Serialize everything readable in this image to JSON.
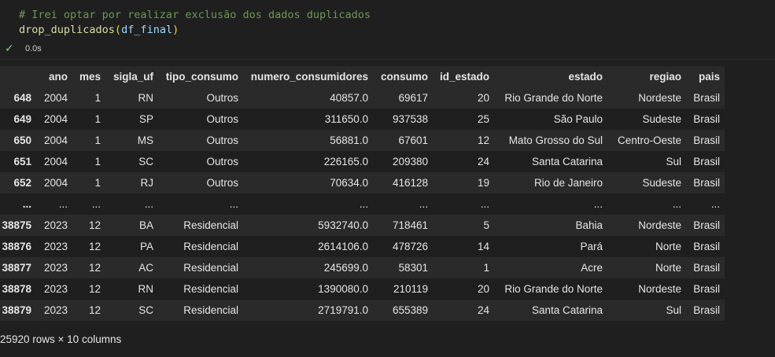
{
  "code": {
    "comment": "# Irei optar por realizar exclusão dos dados duplicados",
    "fn_name": "drop_duplicados",
    "open_paren": "(",
    "arg": "df_final",
    "close_paren": ")"
  },
  "status": {
    "duration": "0.0s"
  },
  "table": {
    "columns": [
      "",
      "ano",
      "mes",
      "sigla_uf",
      "tipo_consumo",
      "numero_consumidores",
      "consumo",
      "id_estado",
      "estado",
      "regiao",
      "pais"
    ],
    "rows": [
      [
        "648",
        "2004",
        "1",
        "RN",
        "Outros",
        "40857.0",
        "69617",
        "20",
        "Rio Grande do Norte",
        "Nordeste",
        "Brasil"
      ],
      [
        "649",
        "2004",
        "1",
        "SP",
        "Outros",
        "311650.0",
        "937538",
        "25",
        "São Paulo",
        "Sudeste",
        "Brasil"
      ],
      [
        "650",
        "2004",
        "1",
        "MS",
        "Outros",
        "56881.0",
        "67601",
        "12",
        "Mato Grosso do Sul",
        "Centro-Oeste",
        "Brasil"
      ],
      [
        "651",
        "2004",
        "1",
        "SC",
        "Outros",
        "226165.0",
        "209380",
        "24",
        "Santa Catarina",
        "Sul",
        "Brasil"
      ],
      [
        "652",
        "2004",
        "1",
        "RJ",
        "Outros",
        "70634.0",
        "416128",
        "19",
        "Rio de Janeiro",
        "Sudeste",
        "Brasil"
      ],
      [
        "...",
        "...",
        "...",
        "...",
        "...",
        "...",
        "...",
        "...",
        "...",
        "...",
        "..."
      ],
      [
        "38875",
        "2023",
        "12",
        "BA",
        "Residencial",
        "5932740.0",
        "718461",
        "5",
        "Bahia",
        "Nordeste",
        "Brasil"
      ],
      [
        "38876",
        "2023",
        "12",
        "PA",
        "Residencial",
        "2614106.0",
        "478726",
        "14",
        "Pará",
        "Norte",
        "Brasil"
      ],
      [
        "38877",
        "2023",
        "12",
        "AC",
        "Residencial",
        "245699.0",
        "58301",
        "1",
        "Acre",
        "Norte",
        "Brasil"
      ],
      [
        "38878",
        "2023",
        "12",
        "RN",
        "Residencial",
        "1390080.0",
        "210119",
        "20",
        "Rio Grande do Norte",
        "Nordeste",
        "Brasil"
      ],
      [
        "38879",
        "2023",
        "12",
        "SC",
        "Residencial",
        "2719791.0",
        "655389",
        "24",
        "Santa Catarina",
        "Sul",
        "Brasil"
      ]
    ]
  },
  "footer": {
    "shape": "25920 rows × 10 columns"
  }
}
